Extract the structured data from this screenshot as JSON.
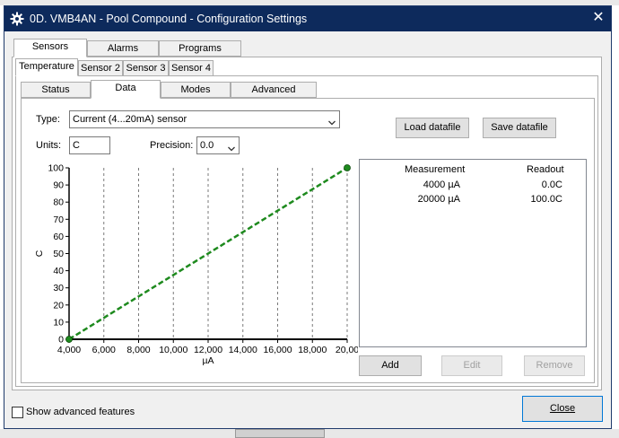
{
  "window": {
    "title": "0D. VMB4AN - Pool Compound - Configuration Settings",
    "close_glyph": "✕"
  },
  "tabs_main": [
    {
      "label": "Sensors",
      "active": true
    },
    {
      "label": "Alarms",
      "active": false
    },
    {
      "label": "Programs",
      "active": false
    }
  ],
  "tabs_sensor": [
    {
      "label": "Temperature",
      "active": true
    },
    {
      "label": "Sensor 2",
      "active": false
    },
    {
      "label": "Sensor 3",
      "active": false
    },
    {
      "label": "Sensor 4",
      "active": false
    }
  ],
  "tabs_sub": [
    {
      "label": "Status",
      "active": false
    },
    {
      "label": "Data",
      "active": true
    },
    {
      "label": "Modes",
      "active": false
    },
    {
      "label": "Advanced",
      "active": false
    }
  ],
  "form": {
    "type_label": "Type:",
    "type_value": "Current (4...20mA) sensor",
    "units_label": "Units:",
    "units_value": "C",
    "precision_label": "Precision:",
    "precision_value": "0.0"
  },
  "buttons": {
    "load": "Load datafile",
    "save": "Save datafile",
    "add": "Add",
    "edit": "Edit",
    "remove": "Remove",
    "close": "Close"
  },
  "table": {
    "headers": [
      "Measurement",
      "Readout"
    ],
    "rows": [
      {
        "measurement": "4000 µA",
        "readout": "0.0C"
      },
      {
        "measurement": "20000 µA",
        "readout": "100.0C"
      }
    ]
  },
  "footer": {
    "show_advanced_label": "Show advanced features",
    "show_advanced_checked": false
  },
  "icons": {
    "window_icon": "gear-icon",
    "dropdown": "chevron-down-icon"
  },
  "colors": {
    "titlebar": "#0d2a5c",
    "series": "#1e8a1e"
  },
  "chart_data": {
    "type": "line",
    "xlabel": "µA",
    "ylabel": "C",
    "xlim": [
      4000,
      20000
    ],
    "ylim": [
      0,
      100
    ],
    "x_ticks": [
      4000,
      6000,
      8000,
      10000,
      12000,
      14000,
      16000,
      18000,
      20000
    ],
    "x_tick_labels": [
      "4,000",
      "6,000",
      "8,000",
      "10,000",
      "12,000",
      "14,000",
      "16,000",
      "18,000",
      "20,00"
    ],
    "y_ticks": [
      0,
      10,
      20,
      30,
      40,
      50,
      60,
      70,
      80,
      90,
      100
    ],
    "y_tick_labels": [
      "0",
      "10",
      "20",
      "30",
      "40",
      "50",
      "60",
      "70",
      "80",
      "90",
      "100"
    ],
    "grid": "vertical dashed",
    "series": [
      {
        "x": [
          4000,
          20000
        ],
        "y": [
          0,
          100
        ],
        "style": "dashed",
        "markers": true
      }
    ]
  }
}
